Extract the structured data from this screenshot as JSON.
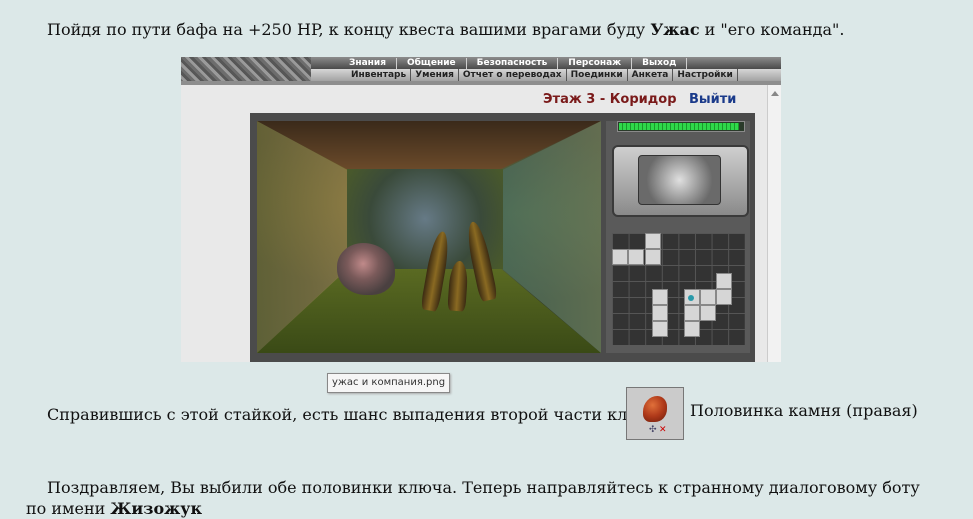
{
  "text": {
    "p1_before": "Пойдя по пути бафа на +250 HP, к концу квеста вашими врагами буду ",
    "p1_bold": "Ужас",
    "p1_after": " и \"его команда\".",
    "p2": "Справившись с этой стайкой, есть шанс выпадения второй части ключа",
    "item_name": "Половинка камня (правая)",
    "p3_before": "Поздравляем, Вы выбили обе половинки ключа. Теперь направляйтесь к странному диалоговому боту по имени ",
    "p3_bold": "Жизожук"
  },
  "game": {
    "menu_top": [
      "Знания",
      "Общение",
      "Безопасность",
      "Персонаж",
      "Выход"
    ],
    "menu_sub": [
      "Инвентарь",
      "Умения",
      "Отчет о переводах",
      "Поединки",
      "Анкета",
      "Настройки"
    ],
    "floor_title": "Этаж 3 - Коридор",
    "exit_label": "Выйти",
    "hp_fraction": 0.97,
    "compass_icon": "compass-icon",
    "monster_icon": "monster-uzhas-icon"
  },
  "image_tooltip": "ужас и компания.png",
  "item": {
    "icon": "stone-half-icon"
  }
}
